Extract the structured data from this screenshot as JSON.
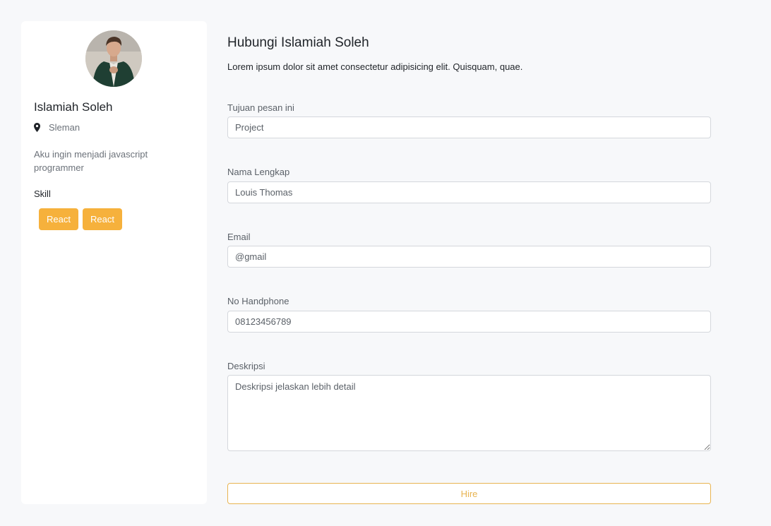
{
  "profile": {
    "name": "Islamiah Soleh",
    "location": "Sleman",
    "bio": "Aku ingin menjadi javascript programmer",
    "skill_heading": "Skill",
    "skills": [
      "React",
      "React"
    ]
  },
  "form": {
    "title": "Hubungi Islamiah Soleh",
    "subtitle": "Lorem ipsum dolor sit amet consectetur adipisicing elit. Quisquam, quae.",
    "fields": {
      "purpose": {
        "label": "Tujuan pesan ini",
        "value": "Project"
      },
      "full_name": {
        "label": "Nama Lengkap",
        "value": "Louis Thomas"
      },
      "email": {
        "label": "Email",
        "value": "@gmail"
      },
      "phone": {
        "label": "No Handphone",
        "value": "08123456789"
      },
      "description": {
        "label": "Deskripsi",
        "placeholder": "Deskripsi jelaskan lebih detail"
      }
    },
    "submit_label": "Hire"
  },
  "colors": {
    "accent": "#f6b13c",
    "page_background": "#f7f8fa",
    "card_background": "#ffffff"
  },
  "icons": {
    "location": "map-pin-icon"
  }
}
